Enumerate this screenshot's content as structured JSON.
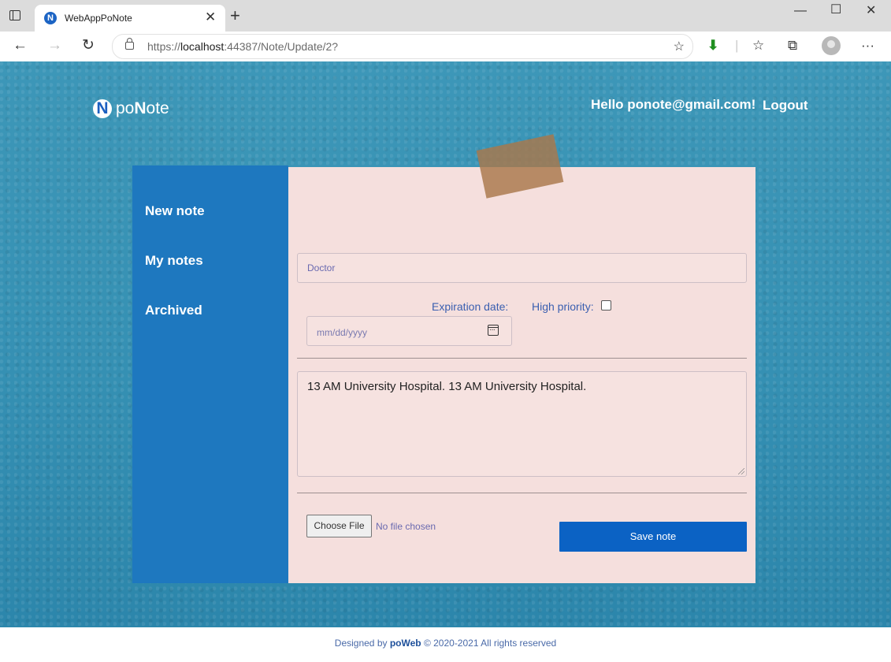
{
  "browser": {
    "tab_title": "WebAppPoNote",
    "favicon_letter": "N",
    "url_prefix": "https://",
    "url_host": "localhost",
    "url_rest": ":44387/Note/Update/2?"
  },
  "header": {
    "logo_letter": "N",
    "logo_prefix": "po",
    "logo_mid": "N",
    "logo_suffix": "ote",
    "greeting": "Hello ponote@gmail.com!",
    "logout_label": "Logout"
  },
  "sidebar": {
    "items": [
      {
        "label": "New note"
      },
      {
        "label": "My notes"
      },
      {
        "label": "Archived"
      }
    ]
  },
  "note": {
    "title_value": "Doctor",
    "expiration_label": "Expiration date:",
    "priority_label": "High priority:",
    "priority_checked": false,
    "date_placeholder": "mm/dd/yyyy",
    "body": "13 AM University Hospital. 13 AM University Hospital.",
    "file_button_label": "Choose File",
    "file_status": "No file chosen",
    "save_label": "Save note"
  },
  "footer": {
    "prefix": "Designed by ",
    "brand": "poWeb",
    "suffix": " © 2020-2021 All rights reserved"
  },
  "colors": {
    "sidebar": "#1e78bf",
    "card": "#f5dfdd",
    "accent": "#0b62c4",
    "background": "#3a93b5"
  }
}
